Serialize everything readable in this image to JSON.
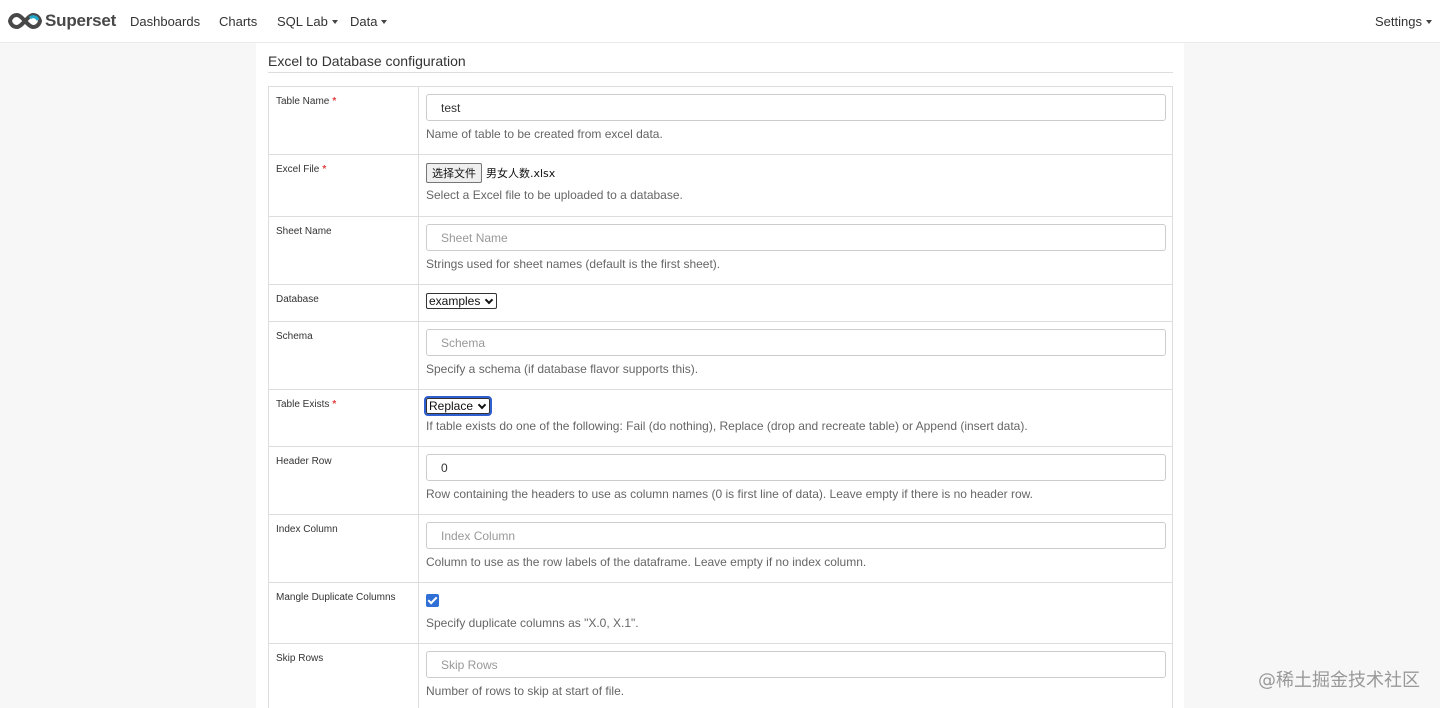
{
  "navbar": {
    "brand": "Superset",
    "items": [
      "Dashboards",
      "Charts",
      "SQL Lab",
      "Data"
    ],
    "settings": "Settings"
  },
  "form": {
    "title": "Excel to Database configuration",
    "table_name": {
      "label": "Table Name",
      "value": "test",
      "help": "Name of table to be created from excel data."
    },
    "excel_file": {
      "label": "Excel File",
      "button": "选择文件",
      "filename": "男女人数.xlsx",
      "help": "Select a Excel file to be uploaded to a database."
    },
    "sheet_name": {
      "label": "Sheet Name",
      "placeholder": "Sheet Name",
      "help": "Strings used for sheet names (default is the first sheet)."
    },
    "database": {
      "label": "Database",
      "selected": "examples"
    },
    "schema": {
      "label": "Schema",
      "placeholder": "Schema",
      "help": "Specify a schema (if database flavor supports this)."
    },
    "table_exists": {
      "label": "Table Exists",
      "selected": "Replace",
      "help": "If table exists do one of the following: Fail (do nothing), Replace (drop and recreate table) or Append (insert data)."
    },
    "header_row": {
      "label": "Header Row",
      "value": "0",
      "help": "Row containing the headers to use as column names (0 is first line of data). Leave empty if there is no header row."
    },
    "index_column": {
      "label": "Index Column",
      "placeholder": "Index Column",
      "help": "Column to use as the row labels of the dataframe. Leave empty if no index column."
    },
    "mangle_dupe": {
      "label": "Mangle Duplicate Columns",
      "checked": true,
      "help": "Specify duplicate columns as \"X.0, X.1\"."
    },
    "skip_rows": {
      "label": "Skip Rows",
      "placeholder": "Skip Rows",
      "help": "Number of rows to skip at start of file."
    }
  },
  "watermark": "@稀土掘金技术社区",
  "colors": {
    "required": "#e04141",
    "checkbox": "#2f6fd6",
    "focus": "#2f5fd0"
  }
}
